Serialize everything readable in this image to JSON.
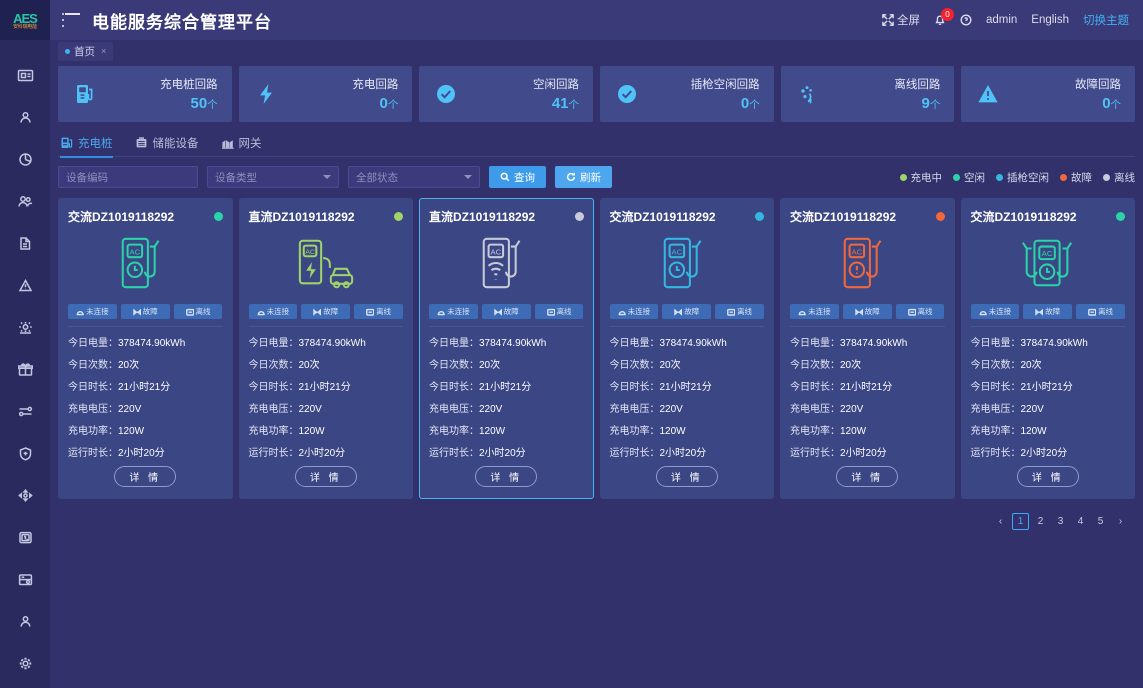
{
  "brand": {
    "mark": "AES",
    "sub": "安科瑞电能"
  },
  "header": {
    "title": "电能服务综合管理平台",
    "fullscreen": "全屏",
    "notifications_count": "0",
    "user": "admin",
    "language": "English",
    "theme_switch": "切换主题"
  },
  "page_tab": {
    "label": "首页",
    "close": "×"
  },
  "sidebar": {
    "items": [
      {
        "name": "sidebar-item-monitor",
        "icon": "monitor-icon"
      },
      {
        "name": "sidebar-item-user",
        "icon": "user-icon"
      },
      {
        "name": "sidebar-item-chart",
        "icon": "pie-chart-icon"
      },
      {
        "name": "sidebar-item-group",
        "icon": "users-icon"
      },
      {
        "name": "sidebar-item-document",
        "icon": "file-icon"
      },
      {
        "name": "sidebar-item-alarm",
        "icon": "warning-icon"
      },
      {
        "name": "sidebar-item-device",
        "icon": "settings-gear-icon"
      },
      {
        "name": "sidebar-item-gift",
        "icon": "gift-icon"
      },
      {
        "name": "sidebar-item-flow",
        "icon": "transfer-icon"
      },
      {
        "name": "sidebar-item-security",
        "icon": "shield-icon"
      },
      {
        "name": "sidebar-item-energy",
        "icon": "move-icon"
      },
      {
        "name": "sidebar-item-meter",
        "icon": "meter-icon"
      },
      {
        "name": "sidebar-item-storage",
        "icon": "save-icon"
      },
      {
        "name": "sidebar-item-account",
        "icon": "person-icon"
      },
      {
        "name": "sidebar-item-settings",
        "icon": "gear-icon"
      }
    ]
  },
  "stats": [
    {
      "label": "充电桩回路",
      "value": "50",
      "unit": "个",
      "icon": "charging-pile-icon"
    },
    {
      "label": "充电回路",
      "value": "0",
      "unit": "个",
      "icon": "bolt-icon"
    },
    {
      "label": "空闲回路",
      "value": "41",
      "unit": "个",
      "icon": "check-circle-icon"
    },
    {
      "label": "插枪空闲回路",
      "value": "0",
      "unit": "个",
      "icon": "check-circle-icon"
    },
    {
      "label": "离线回路",
      "value": "9",
      "unit": "个",
      "icon": "offline-icon"
    },
    {
      "label": "故障回路",
      "value": "0",
      "unit": "个",
      "icon": "warning-triangle-icon"
    }
  ],
  "tabs": [
    {
      "label": "充电桩",
      "icon": "charging-pile-icon",
      "active": true
    },
    {
      "label": "储能设备",
      "icon": "battery-icon",
      "active": false
    },
    {
      "label": "网关",
      "icon": "gateway-icon",
      "active": false
    }
  ],
  "filters": {
    "device_code_placeholder": "设备编码",
    "device_code_value": "",
    "device_type_selected": "设备类型",
    "status_selected": "全部状态",
    "search_label": "查询",
    "refresh_label": "刷新"
  },
  "legend": [
    {
      "label": "充电中",
      "color": "#a0d468"
    },
    {
      "label": "空闲",
      "color": "#2bd4a8"
    },
    {
      "label": "插枪空闲",
      "color": "#35b8e0"
    },
    {
      "label": "故障",
      "color": "#f0683c"
    },
    {
      "label": "离线",
      "color": "#c8cada"
    }
  ],
  "card_tags": [
    {
      "label": "未连接",
      "icon": "plug-disconnected-icon"
    },
    {
      "label": "故障",
      "icon": "fault-icon"
    },
    {
      "label": "离线",
      "icon": "offline-icon"
    }
  ],
  "card_rows": [
    {
      "key": "今日电量：",
      "value": "378474.90kWh"
    },
    {
      "key": "今日次数：",
      "value": "20次"
    },
    {
      "key": "今日时长：",
      "value": "21小时21分"
    },
    {
      "key": "充电电压：",
      "value": "220V"
    },
    {
      "key": "充电功率：",
      "value": "120W"
    },
    {
      "key": "运行时长：",
      "value": "2小时20分"
    }
  ],
  "detail_label": "详 情",
  "cards": [
    {
      "title": "交流DZ1019118292",
      "type": "ac",
      "status_color": "#2bd4a8",
      "icon_color": "#2bd4a8",
      "selected": false,
      "glyph": "ac-clock"
    },
    {
      "title": "直流DZ1019118292",
      "type": "dc",
      "status_color": "#a0d468",
      "icon_color": "#a0d468",
      "selected": false,
      "glyph": "dc-car"
    },
    {
      "title": "直流DZ1019118292",
      "type": "dc",
      "status_color": "#c8cada",
      "icon_color": "#c8cada",
      "selected": true,
      "glyph": "dc-wifi"
    },
    {
      "title": "交流DZ1019118292",
      "type": "ac",
      "status_color": "#35b8e0",
      "icon_color": "#35b8e0",
      "selected": false,
      "glyph": "ac-clock"
    },
    {
      "title": "交流DZ1019118292",
      "type": "ac",
      "status_color": "#f0683c",
      "icon_color": "#f0683c",
      "selected": false,
      "glyph": "ac-alert"
    },
    {
      "title": "交流DZ1019118292",
      "type": "ac",
      "status_color": "#2bd4a8",
      "icon_color": "#2bd4a8",
      "selected": false,
      "glyph": "ac-double"
    }
  ],
  "pagination": {
    "prev": "‹",
    "next": "›",
    "pages": [
      "1",
      "2",
      "3",
      "4",
      "5"
    ],
    "current": "1"
  }
}
